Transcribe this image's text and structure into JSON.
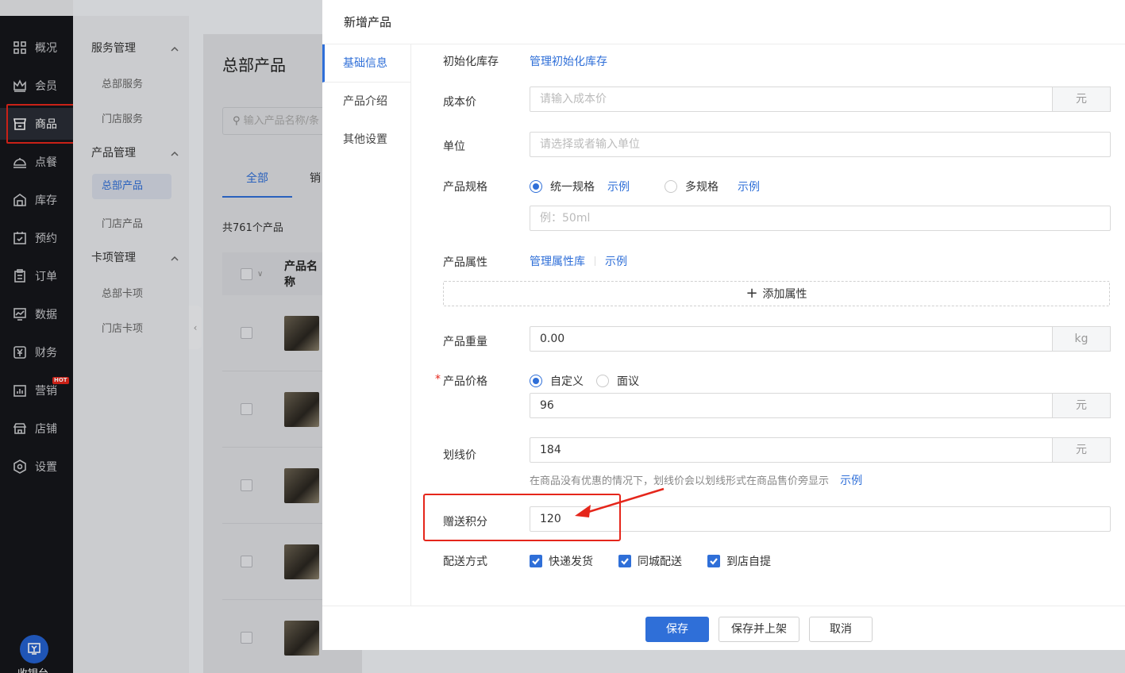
{
  "sidebar": {
    "items": [
      {
        "label": "概况",
        "icon": "grid-icon"
      },
      {
        "label": "会员",
        "icon": "crown-icon"
      },
      {
        "label": "商品",
        "icon": "store-icon"
      },
      {
        "label": "点餐",
        "icon": "dish-icon"
      },
      {
        "label": "库存",
        "icon": "warehouse-icon"
      },
      {
        "label": "预约",
        "icon": "calendar-check-icon"
      },
      {
        "label": "订单",
        "icon": "clipboard-icon"
      },
      {
        "label": "数据",
        "icon": "chart-icon"
      },
      {
        "label": "财务",
        "icon": "yuan-icon"
      },
      {
        "label": "营销",
        "icon": "bar-chart-icon"
      },
      {
        "label": "店铺",
        "icon": "shop-icon"
      },
      {
        "label": "设置",
        "icon": "settings-icon"
      }
    ],
    "hot_badge": "HOT",
    "cashier_label": "收银台"
  },
  "subnav": {
    "groups": [
      {
        "title": "服务管理",
        "links": [
          "总部服务",
          "门店服务"
        ]
      },
      {
        "title": "产品管理",
        "links": [
          "总部产品",
          "门店产品"
        ]
      },
      {
        "title": "卡项管理",
        "links": [
          "总部卡项",
          "门店卡项"
        ]
      }
    ]
  },
  "main": {
    "page_title": "总部产品",
    "search_placeholder": "输入产品名称/条",
    "tab_all": "全部",
    "tab_sales": "销",
    "count_text": "共761个产品",
    "column_name": "产品名称"
  },
  "drawer": {
    "title": "新增产品",
    "tabs": [
      "基础信息",
      "产品介绍",
      "其他设置"
    ],
    "fields": {
      "init_stock_label": "初始化库存",
      "init_stock_link": "管理初始化库存",
      "cost_label": "成本价",
      "cost_placeholder": "请输入成本价",
      "cost_unit": "元",
      "unit_label": "单位",
      "unit_placeholder": "请选择或者输入单位",
      "spec_label": "产品规格",
      "spec_option_single": "统一规格",
      "spec_option_multi": "多规格",
      "example": "示例",
      "spec_placeholder": "例：50ml",
      "attr_label": "产品属性",
      "attr_link": "管理属性库",
      "add_attr": "添加属性",
      "weight_label": "产品重量",
      "weight_value": "0.00",
      "weight_unit": "kg",
      "price_label": "产品价格",
      "price_option_custom": "自定义",
      "price_option_negotiable": "面议",
      "price_value": "96",
      "price_unit": "元",
      "strike_label": "划线价",
      "strike_value": "184",
      "strike_unit": "元",
      "strike_hint": "在商品没有优惠的情况下，划线价会以划线形式在商品售价旁显示",
      "points_label": "赠送积分",
      "points_value": "120",
      "delivery_label": "配送方式",
      "delivery_options": [
        "快递发货",
        "同城配送",
        "到店自提"
      ]
    },
    "footer": {
      "save": "保存",
      "save_publish": "保存并上架",
      "cancel": "取消"
    }
  },
  "colors": {
    "accent": "#2f6fd8",
    "highlight": "#e5261b",
    "sidebar_bg": "#15161b"
  }
}
